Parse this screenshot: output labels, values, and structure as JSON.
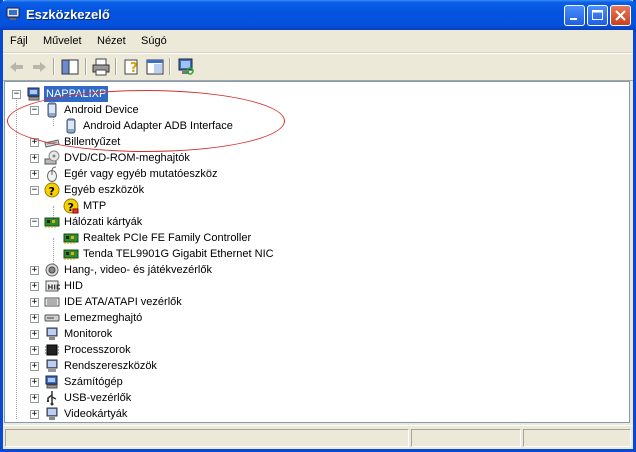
{
  "window": {
    "title": "Eszközkezelő"
  },
  "menubar": [
    "Fájl",
    "Művelet",
    "Nézet",
    "Súgó"
  ],
  "tree": {
    "root": "NAPPALIXP",
    "nodes": [
      {
        "label": "Android Device",
        "icon": "android-device-icon",
        "expanded": true,
        "children": [
          {
            "label": "Android Adapter ADB Interface",
            "icon": "adb-interface-icon"
          }
        ]
      },
      {
        "label": "Billentyűzet",
        "icon": "keyboard-icon"
      },
      {
        "label": "DVD/CD-ROM-meghajtók",
        "icon": "cdrom-icon"
      },
      {
        "label": "Egér vagy egyéb mutatóeszköz",
        "icon": "mouse-icon"
      },
      {
        "label": "Egyéb eszközök",
        "icon": "unknown-device-icon",
        "expanded": true,
        "children": [
          {
            "label": "MTP",
            "icon": "warning-question-icon"
          }
        ]
      },
      {
        "label": "Hálózati kártyák",
        "icon": "network-card-icon",
        "expanded": true,
        "children": [
          {
            "label": "Realtek PCIe FE Family Controller",
            "icon": "network-card-icon"
          },
          {
            "label": "Tenda TEL9901G Gigabit Ethernet NIC",
            "icon": "network-card-icon"
          }
        ]
      },
      {
        "label": "Hang-, video- és játékvezérlők",
        "icon": "speaker-icon"
      },
      {
        "label": "HID",
        "icon": "hid-icon"
      },
      {
        "label": "IDE ATA/ATAPI vezérlők",
        "icon": "ide-controller-icon"
      },
      {
        "label": "Lemezmeghajtó",
        "icon": "disk-drive-icon"
      },
      {
        "label": "Monitorok",
        "icon": "monitor-icon"
      },
      {
        "label": "Processzorok",
        "icon": "processor-icon"
      },
      {
        "label": "Rendszereszközök",
        "icon": "system-device-icon"
      },
      {
        "label": "Számítógép",
        "icon": "computer-icon"
      },
      {
        "label": "USB-vezérlők",
        "icon": "usb-icon"
      },
      {
        "label": "Videokártyák",
        "icon": "display-adapter-icon"
      }
    ]
  },
  "colors": {
    "highlight": "#316ac5",
    "annotation": "#d83030",
    "titlebar": "#0453e0"
  }
}
